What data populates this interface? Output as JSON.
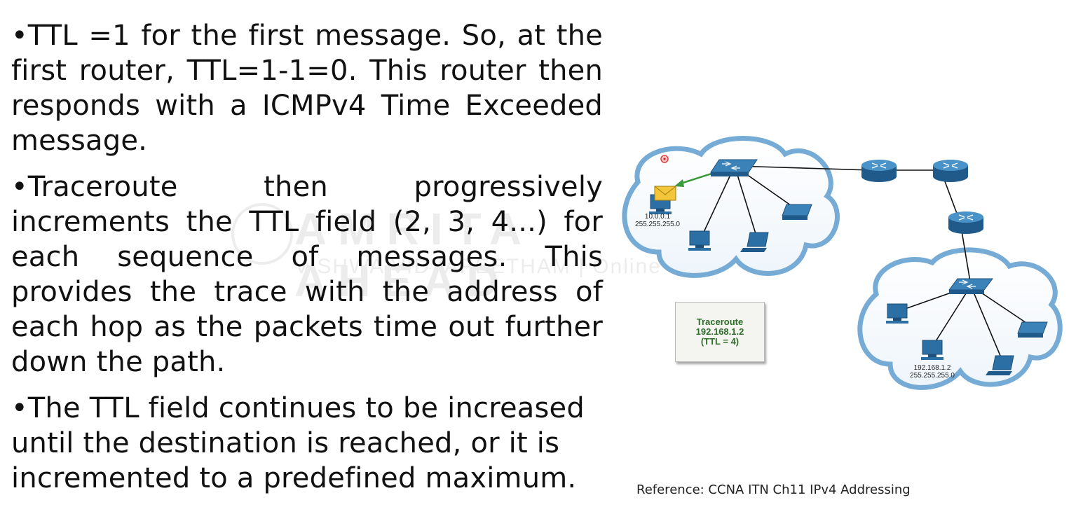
{
  "bullets": [
    "•TTL =1 for the first message. So, at the first router, TTL=1-1=0. This router then responds with a ICMPv4 Time Exceeded message.",
    "•Traceroute then progressively increments the TTL field (2, 3, 4...) for each sequence of messages. This provides the trace with the address of each hop as the packets time out further down the path.",
    "•The TTL field continues to be increased until the destination is reached, or it is incremented to a predefined maximum."
  ],
  "watermark": {
    "main": "AMRITA AHEAD",
    "sub": "VISHWA VIDYAPEETHAM | Online"
  },
  "diagram": {
    "source_host": {
      "ip": "10.0.0.1",
      "mask": "255.255.255.0"
    },
    "dest_host": {
      "ip": "192.168.1.2",
      "mask": "255.255.255.0"
    },
    "trace_box": {
      "line1": "Traceroute",
      "line2": "192.168.1.2",
      "line3": "(TTL = 4)"
    },
    "colors": {
      "cloud": "#5b9bc7",
      "device": "#2b6fa5",
      "arrow": "#3a9a3a",
      "label": "#2e6e2a"
    }
  },
  "reference": "Reference: CCNA ITN Ch11 IPv4 Addressing"
}
